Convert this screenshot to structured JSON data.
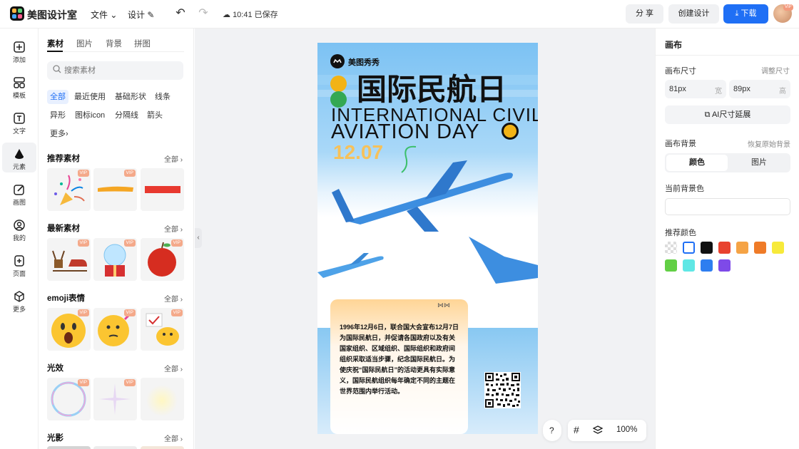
{
  "app": {
    "name": "美图设计室"
  },
  "topbar": {
    "file_menu": "文件",
    "design_menu": "设计",
    "save_status": "10:41 已保存",
    "share": "分 享",
    "create_design": "创建设计",
    "download": "下载",
    "avatar_badge": "VIP"
  },
  "leftrail": {
    "items": [
      {
        "label": "添加",
        "icon": "plus-square-icon"
      },
      {
        "label": "模板",
        "icon": "template-icon"
      },
      {
        "label": "文字",
        "icon": "text-icon"
      },
      {
        "label": "元素",
        "icon": "shapes-icon"
      },
      {
        "label": "画图",
        "icon": "draw-icon"
      },
      {
        "label": "我的",
        "icon": "user-icon"
      },
      {
        "label": "页面",
        "icon": "page-add-icon"
      },
      {
        "label": "更多",
        "icon": "cube-icon"
      }
    ]
  },
  "panel": {
    "tabs": [
      "素材",
      "图片",
      "背景",
      "拼图"
    ],
    "search_placeholder": "搜索素材",
    "chips": [
      "全部",
      "最近使用",
      "基础形状",
      "线条",
      "异形",
      "图标icon",
      "分隔线",
      "箭头",
      "更多"
    ],
    "sections": [
      {
        "title": "推荐素材",
        "all": "全部"
      },
      {
        "title": "最新素材",
        "all": "全部"
      },
      {
        "title": "emoji表情",
        "all": "全部"
      },
      {
        "title": "光效",
        "all": "全部"
      },
      {
        "title": "光影",
        "all": "全部"
      }
    ],
    "vip_label": "VIP"
  },
  "poster": {
    "brand": "美图秀秀",
    "title_cn": "国际民航日",
    "title_en_1": "INTERNATIONAL CIVIL",
    "title_en_2": "AVIATION DAY",
    "date": "12.07",
    "body": "1996年12月6日，联合国大会宣布12月7日为国际民航日，并促请各国政府以及有关国家组织、区域组织、国际组织和政府间组织采取适当步骤，纪念国际民航日。为使庆祝“国际民航日”的活动更具有实际意义，国际民航组织每年确定不同的主题在世界范围内举行活动。"
  },
  "canvas_tools": {
    "help": "?",
    "zoom": "100%"
  },
  "rightpanel": {
    "title": "画布",
    "size_label": "画布尺寸",
    "adjust_size": "调整尺寸",
    "width_value": "81px",
    "width_unit": "宽",
    "height_value": "89px",
    "height_unit": "高",
    "ai_extend": "AI尺寸延展",
    "bg_label": "画布背景",
    "restore_bg": "恢复原始背景",
    "tab_color": "颜色",
    "tab_image": "图片",
    "current_bg": "当前背景色",
    "recommend": "推荐颜色",
    "colors": [
      "transparent",
      "#ffffff",
      "#111111",
      "#e8422f",
      "#f5a345",
      "#ef7b28",
      "#f7ea3a",
      "#62cf45",
      "#5fe7e5",
      "#2e7ef0",
      "#7e4ae8"
    ]
  }
}
